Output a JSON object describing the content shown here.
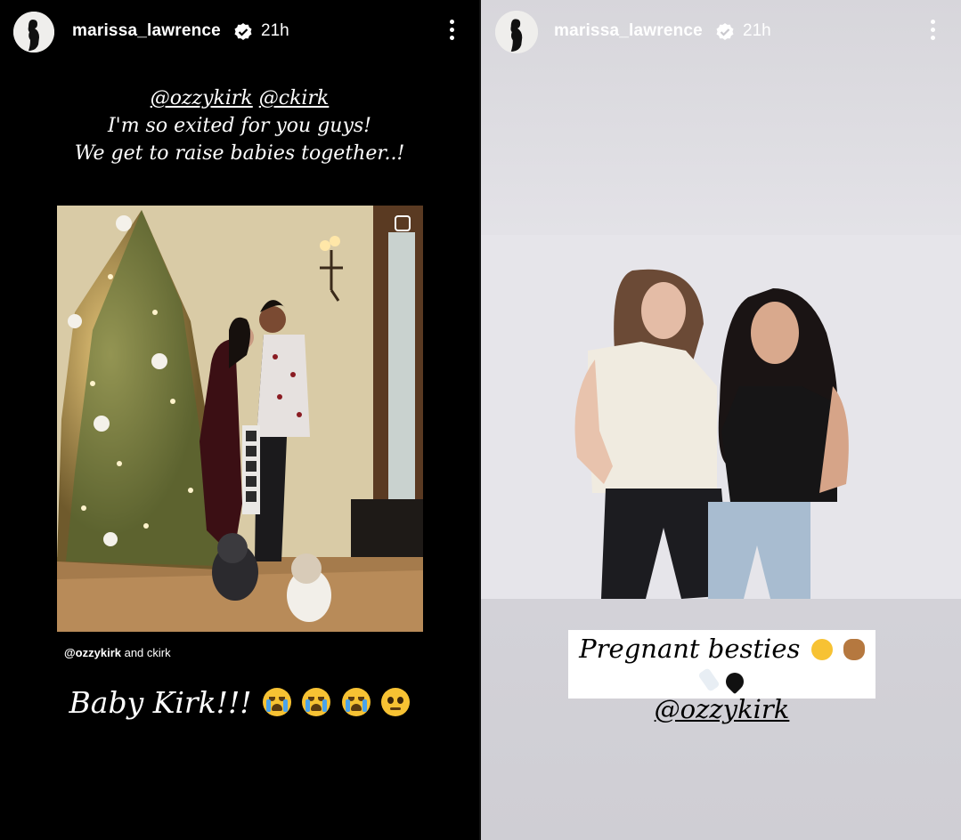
{
  "stories": [
    {
      "header": {
        "username": "marissa_lawrence",
        "time": "21h",
        "more_icon": "more-vertical-icon"
      },
      "caption": {
        "mention1": "@ozzykirk",
        "mention2": "@ckirk",
        "line2": "I'm so exited for you guys!",
        "line3": "We get to raise babies together..!"
      },
      "embedded_post": {
        "credit_handle": "@ozzykirk",
        "credit_rest": " and ckirk"
      },
      "sticker": {
        "text": "Baby Kirk!!!"
      }
    },
    {
      "header": {
        "username": "marissa_lawrence",
        "time": "21h",
        "more_icon": "more-vertical-icon"
      },
      "sticker": {
        "line1": "Pregnant besties",
        "mention": "@ozzykirk"
      }
    }
  ],
  "colors": {
    "verified_badge": "#ffffff",
    "left_background": "#000000",
    "right_background": "#e0dfe4"
  }
}
